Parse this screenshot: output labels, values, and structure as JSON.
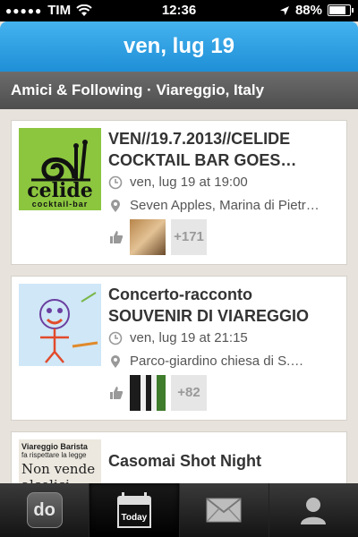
{
  "status": {
    "carrier": "TIM",
    "time": "12:36",
    "battery": "88%",
    "battery_level": 0.88
  },
  "header": {
    "title": "ven, lug 19"
  },
  "subheader": {
    "text": "Amici & Following · Viareggio, Italy"
  },
  "events": [
    {
      "title": "VEN//19.7.2013//CELIDE COCKTAIL BAR GOES…",
      "datetime": "ven, lug 19 at 19:00",
      "location": "Seven Apples, Marina di Pietr…",
      "more_count": "+171",
      "logo_text": "celide",
      "logo_sub": "cocktail-bar"
    },
    {
      "title": "Concerto-racconto SOUVENIR DI VIAREGGIO",
      "datetime": "ven, lug 19 at 21:15",
      "location": "Parco-giardino chiesa di S.…",
      "more_count": "+82"
    },
    {
      "title": "Casomai Shot Night",
      "thumb_line1": "Viareggio Barista",
      "thumb_line2": "fa rispettare la legge",
      "thumb_line3": "Non vende",
      "thumb_line4": "alcolici"
    }
  ],
  "tabs": {
    "do_label": "do",
    "today_label": "Today"
  },
  "colors": {
    "header_blue": "#2a9be0",
    "logo_green": "#8cc63f"
  }
}
